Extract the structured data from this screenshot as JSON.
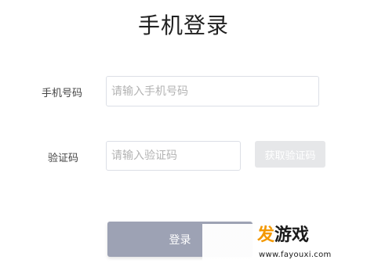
{
  "page": {
    "title": "手机登录"
  },
  "form": {
    "phone_label": "手机号码",
    "phone_placeholder": "请输入手机号码",
    "phone_value": "",
    "code_label": "验证码",
    "code_placeholder": "请输入验证码",
    "code_value": "",
    "get_code_label": "获取验证码",
    "login_label": "登录"
  },
  "watermark": {
    "logo_part_a": "发",
    "logo_part_b": "游戏",
    "url": "www.fayouxi.com"
  },
  "colors": {
    "login_button": "#9da2b4",
    "get_code_button": "#e6e7e9",
    "input_border": "#dcdfe6",
    "watermark_accent": "#f39800"
  }
}
